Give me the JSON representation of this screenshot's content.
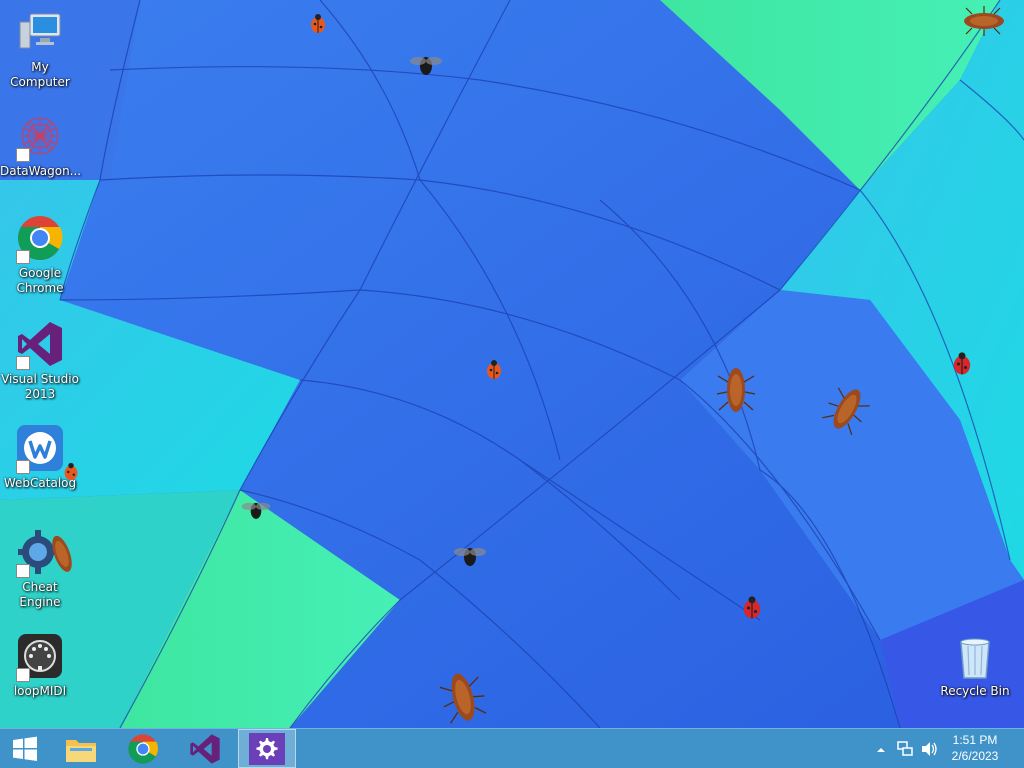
{
  "desktop": {
    "icons": [
      {
        "label": "My Computer",
        "icon": "computer-icon"
      },
      {
        "label": "DataWagon...",
        "icon": "datawagon-icon"
      },
      {
        "label": "Google Chrome",
        "icon": "chrome-icon"
      },
      {
        "label": "Visual Studio 2013",
        "icon": "visual-studio-icon"
      },
      {
        "label": "WebCatalog",
        "icon": "webcatalog-icon"
      },
      {
        "label": "Cheat Engine",
        "icon": "cheat-engine-icon"
      },
      {
        "label": "loopMIDI",
        "icon": "loopmidi-icon"
      },
      {
        "label": "Recycle Bin",
        "icon": "recycle-bin-icon"
      }
    ],
    "bugs": [
      "ladybug",
      "fly",
      "cockroach"
    ]
  },
  "taskbar": {
    "pinned": [
      {
        "name": "start",
        "icon": "windows-logo-icon"
      },
      {
        "name": "file-explorer",
        "icon": "folder-icon"
      },
      {
        "name": "chrome",
        "icon": "chrome-icon"
      },
      {
        "name": "visual-studio",
        "icon": "visual-studio-icon"
      },
      {
        "name": "settings",
        "icon": "gear-icon",
        "active": true
      }
    ],
    "tray": {
      "icons": [
        "chevron-up-icon",
        "network-icon",
        "volume-icon"
      ],
      "time": "1:51 PM",
      "date": "2/6/2023"
    }
  },
  "colors": {
    "taskbar": "#3f93c9",
    "wallpaper_blue": "#2f6fe8",
    "wallpaper_cyan": "#2fd4e8",
    "wallpaper_mint": "#48e8a8"
  }
}
